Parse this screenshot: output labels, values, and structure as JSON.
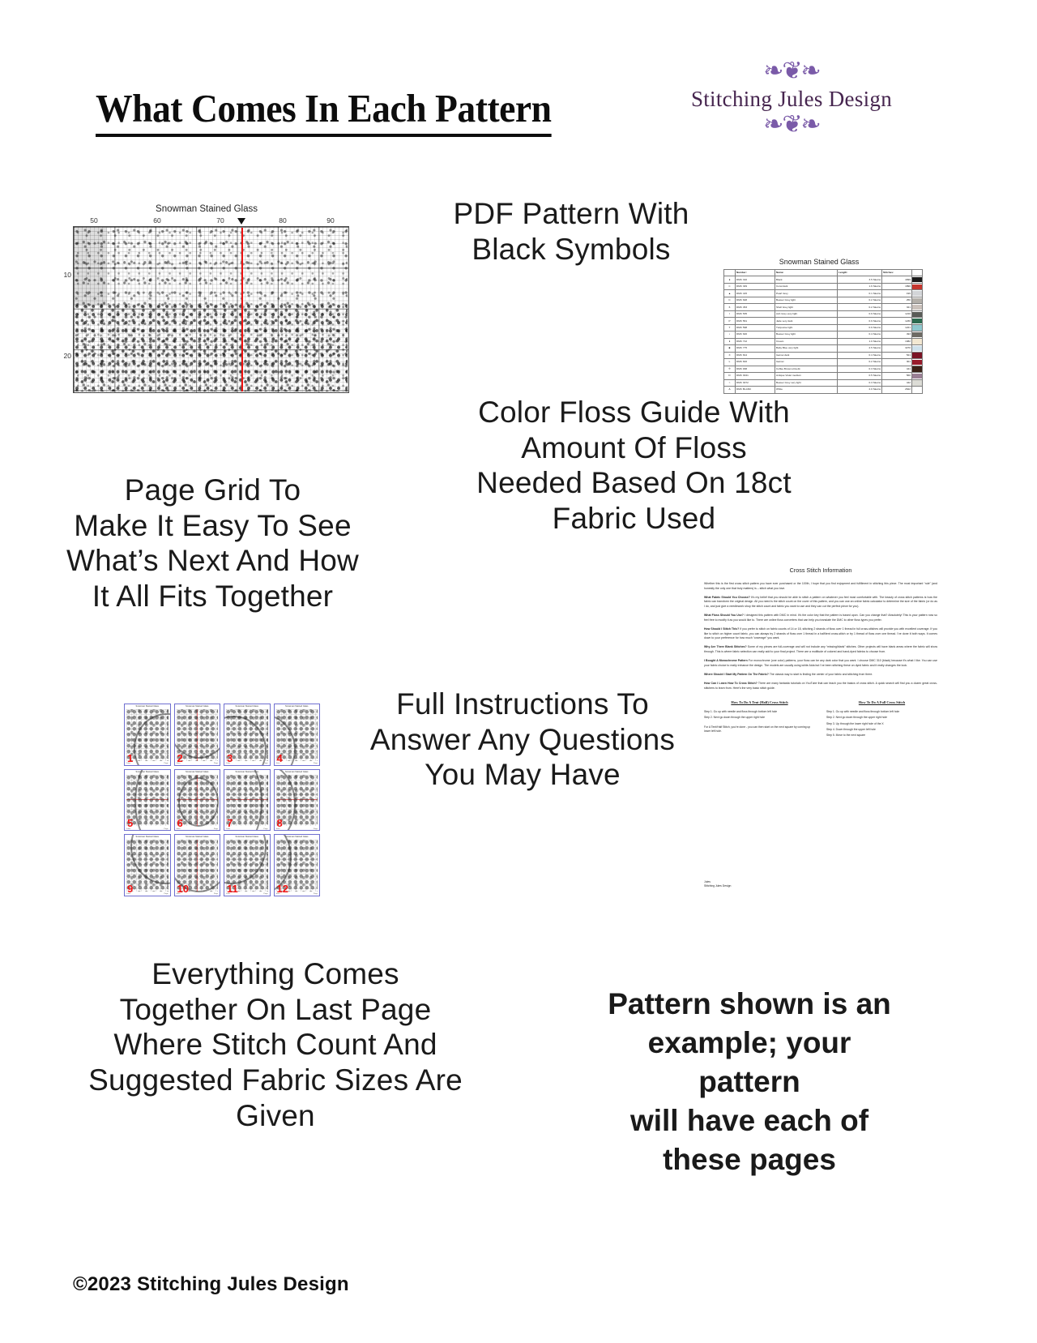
{
  "header": {
    "title": "What Comes In Each Pattern",
    "logo": {
      "name": "Stitching Jules Design",
      "flourish_top": "❧❦❧",
      "flourish_bottom": "❧❦❧",
      "color": "#7a5aa8"
    }
  },
  "headlines": {
    "pdf_pattern": "PDF Pattern With\nBlack Symbols",
    "page_grid": "Page Grid To\nMake It Easy To See\nWhat’s Next And How\nIt All Fits Together",
    "color_floss": "Color Floss Guide With\nAmount Of Floss\nNeeded Based On 18ct\nFabric Used",
    "full_instructions": "Full Instructions To\nAnswer Any Questions\nYou May Have",
    "everything_comes": "Everything Comes\nTogether On Last Page\nWhere Stitch Count And\nSuggested Fabric Sizes Are\nGiven",
    "pattern_example": "Pattern shown is an\nexample; your pattern\nwill have each of\nthese pages"
  },
  "footer": {
    "copyright": "©2023 Stitching Jules Design"
  },
  "chart": {
    "title": "Snowman Stained Glass",
    "column_ticks": [
      "50",
      "60",
      "70",
      "80",
      "90"
    ],
    "row_ticks": [
      "10",
      "20"
    ],
    "center_marker_color": "#ee1111"
  },
  "floss_table": {
    "title": "Snowman Stained Glass",
    "columns": [
      "",
      "Number:",
      "Name:",
      "Length:",
      "Stitches:",
      ""
    ],
    "rows": [
      {
        "symbol": "●",
        "number": "DMC   310",
        "name": "Black",
        "length": "3.5 Skeins",
        "stitches": "4999",
        "color": "#1a1a1a"
      },
      {
        "symbol": "∞",
        "number": "DMC   349",
        "name": "Coral dark",
        "length": "1.6 Skeins",
        "stitches": "1890",
        "color": "#c4362f"
      },
      {
        "symbol": "▲",
        "number": "DMC   415",
        "name": "Pearl Grey",
        "length": "0.1 Skeins",
        "stitches": "199",
        "color": "#d3d5d8"
      },
      {
        "symbol": "C",
        "number": "DMC   648",
        "name": "Beaver Grey light",
        "length": "0.2 Skeins",
        "stitches": "250",
        "color": "#b4b0aa"
      },
      {
        "symbol": "6",
        "number": "DMC   453",
        "name": "Shell Grey light",
        "length": "0.2 Skeins",
        "stitches": "321",
        "color": "#cbc2bc"
      },
      {
        "symbol": "I",
        "number": "DMC   535",
        "name": "Ash Grey very light",
        "length": "0.9 Skeins",
        "stitches": "1210",
        "color": "#5a5c58"
      },
      {
        "symbol": "P",
        "number": "DMC   561",
        "name": "Jade very dark",
        "length": "0.9 Skeins",
        "stitches": "1230",
        "color": "#2c6b50"
      },
      {
        "symbol": "T",
        "number": "DMC   598",
        "name": "Turquoise light",
        "length": "0.9 Skeins",
        "stitches": "1221",
        "color": "#8fc9cf"
      },
      {
        "symbol": "♪",
        "number": "DMC   646",
        "name": "Beaver Grey light",
        "length": "0.4 Skeins",
        "stitches": "493",
        "color": "#6e6b64"
      },
      {
        "symbol": "♦",
        "number": "DMC   712",
        "name": "Cream",
        "length": "1.0 Skeins",
        "stitches": "1382",
        "color": "#f3e8d2"
      },
      {
        "symbol": "■",
        "number": "DMC   775",
        "name": "Baby Blue very light",
        "length": "2.5 Skeins",
        "stitches": "3270",
        "color": "#cfe1ec"
      },
      {
        "symbol": "X",
        "number": "DMC   814",
        "name": "Garnet dark",
        "length": "0.4 Skeins",
        "stitches": "521",
        "color": "#7a1324"
      },
      {
        "symbol": "L",
        "number": "DMC   816",
        "name": "Garnet",
        "length": "0.2 Skeins",
        "stitches": "301",
        "color": "#981c2c"
      },
      {
        "symbol": "※",
        "number": "DMC   938",
        "name": "Coffee Brown ultra dk",
        "length": "0.3 Skeins",
        "stitches": "441",
        "color": "#3b2218"
      },
      {
        "symbol": "D",
        "number": "DMC   3041",
        "name": "Antique Violet medium",
        "length": "0.5 Skeins",
        "stitches": "560",
        "color": "#9a8095"
      },
      {
        "symbol": ">",
        "number": "DMC   3072",
        "name": "Beaver Grey very light",
        "length": "0.3 Skeins",
        "stitches": "442",
        "color": "#dcdcd6"
      },
      {
        "symbol": "Δ",
        "number": "DMC  BLANC",
        "name": "White",
        "length": "2.0 Skeins",
        "stitches": "2622",
        "color": "#ffffff"
      }
    ]
  },
  "page_grid": {
    "thumb_title": "Snowman Stained Glass",
    "thumb_footer_left": "Jules",
    "thumb_footer_right": "Page",
    "numbers": [
      "1",
      "2",
      "3",
      "4",
      "5",
      "6",
      "7",
      "8",
      "9",
      "10",
      "11",
      "12"
    ],
    "border_color": "#6f6fd0",
    "number_color": "#f01414"
  },
  "instructions": {
    "title": "Cross Stitch Information",
    "paragraphs": [
      {
        "lead": "",
        "text": "Whether this is the first cross stitch pattern you have ever purchased or the 100th, I hope that you find enjoyment and fulfillment in stitching this piece. The most important “rule” (and honestly the only one that truly matters) is – stitch what you love."
      },
      {
        "lead": "What Fabric Should You Choose?",
        "text": " It's my belief that you should be able to stitch a pattern on whatever you feel most comfortable with. The beauty of cross stitch patterns is how the fabric can transform the original design. All you need is the stitch count on the cover of this pattern, and you can use an online fabric calculator to determine the size of the fabric (or do as I do, and just give a needlework shop the stitch count and fabric you want to use and they can cut the perfect piece for you)."
      },
      {
        "lead": "What Floss Should You Use?",
        "text": " I designed this pattern with DMC in mind. It's the color key that the pattern is based upon. Can you change that? Absolutely! This is your pattern now so feel free to modify it as you would like to.  There are online floss converters that can help you translate the DMC to other floss types you prefer."
      },
      {
        "lead": "How Should I Stitch This?",
        "text": " If you prefer to stitch on fabric counts of 14 or 18, stitching 2 strands of floss over 1 thread in full cross-stitches will provide you with excellent coverage. If you like to stitch on higher count fabric, you can always try 2 strands of floss over 1 thread in a half/tent cross-stitch or try 1 thread of floss over one thread. I've done it both ways. It comes down to your preference for how much “coverage” you want."
      },
      {
        "lead": "Why Are There Blank Stitches?",
        "text": " Some of my pieces are full-coverage and will not include any “missing/blank” stitches. Other projects will have blank areas where the fabric will show through. This is where fabric selection can really add to your final project. There are a multitude of colored and hand-dyed fabrics to choose from."
      },
      {
        "lead": "I Bought A Monochrome Pattern",
        "text": " For monochrome (one color) patterns, your floss can be any dark color that you want. I choose DMC 310 (black) because it's what I like. You can use your fabric choice to really enhance the design. The models are usually using white Aida but I've been stitching these on dyed fabric and it really changes the look."
      },
      {
        "lead": "Where Should I Start My Pattern On The Fabric?",
        "text": " The classic way to start is finding the center of your fabric and stitching from there."
      },
      {
        "lead": "How Can I Learn How To Cross Stitch?",
        "text": " There are many fantastic tutorials on YouTube that can teach you the basics of cross stitch. A quick search will find you a dozen great cross-stitchers to learn from. Here's the very basic stitch guide."
      }
    ],
    "half_stitch": {
      "heading": "How To Do A Tent (Half) Cross Stitch",
      "steps": [
        "Step 1. Go up with needle and floss through bottom left hole",
        "Step 2. Next go down through the upper right hole"
      ],
      "note": "For A Tent/Half Stitch, you're done - you can then start on the next square by coming up lower left hole."
    },
    "full_stitch": {
      "heading": "How To Do A Full Cross Stitch",
      "steps": [
        "Step 1. Go up with needle and floss through bottom left hole",
        "Step 2. Next go down through the upper right hole",
        "Step 3. Up through the lower right hole of the X",
        "Step 4. Down through the upper left hole",
        "Step 5. Move to the next square"
      ]
    },
    "signature": [
      "Jules",
      "Stitching Jules Design"
    ]
  }
}
